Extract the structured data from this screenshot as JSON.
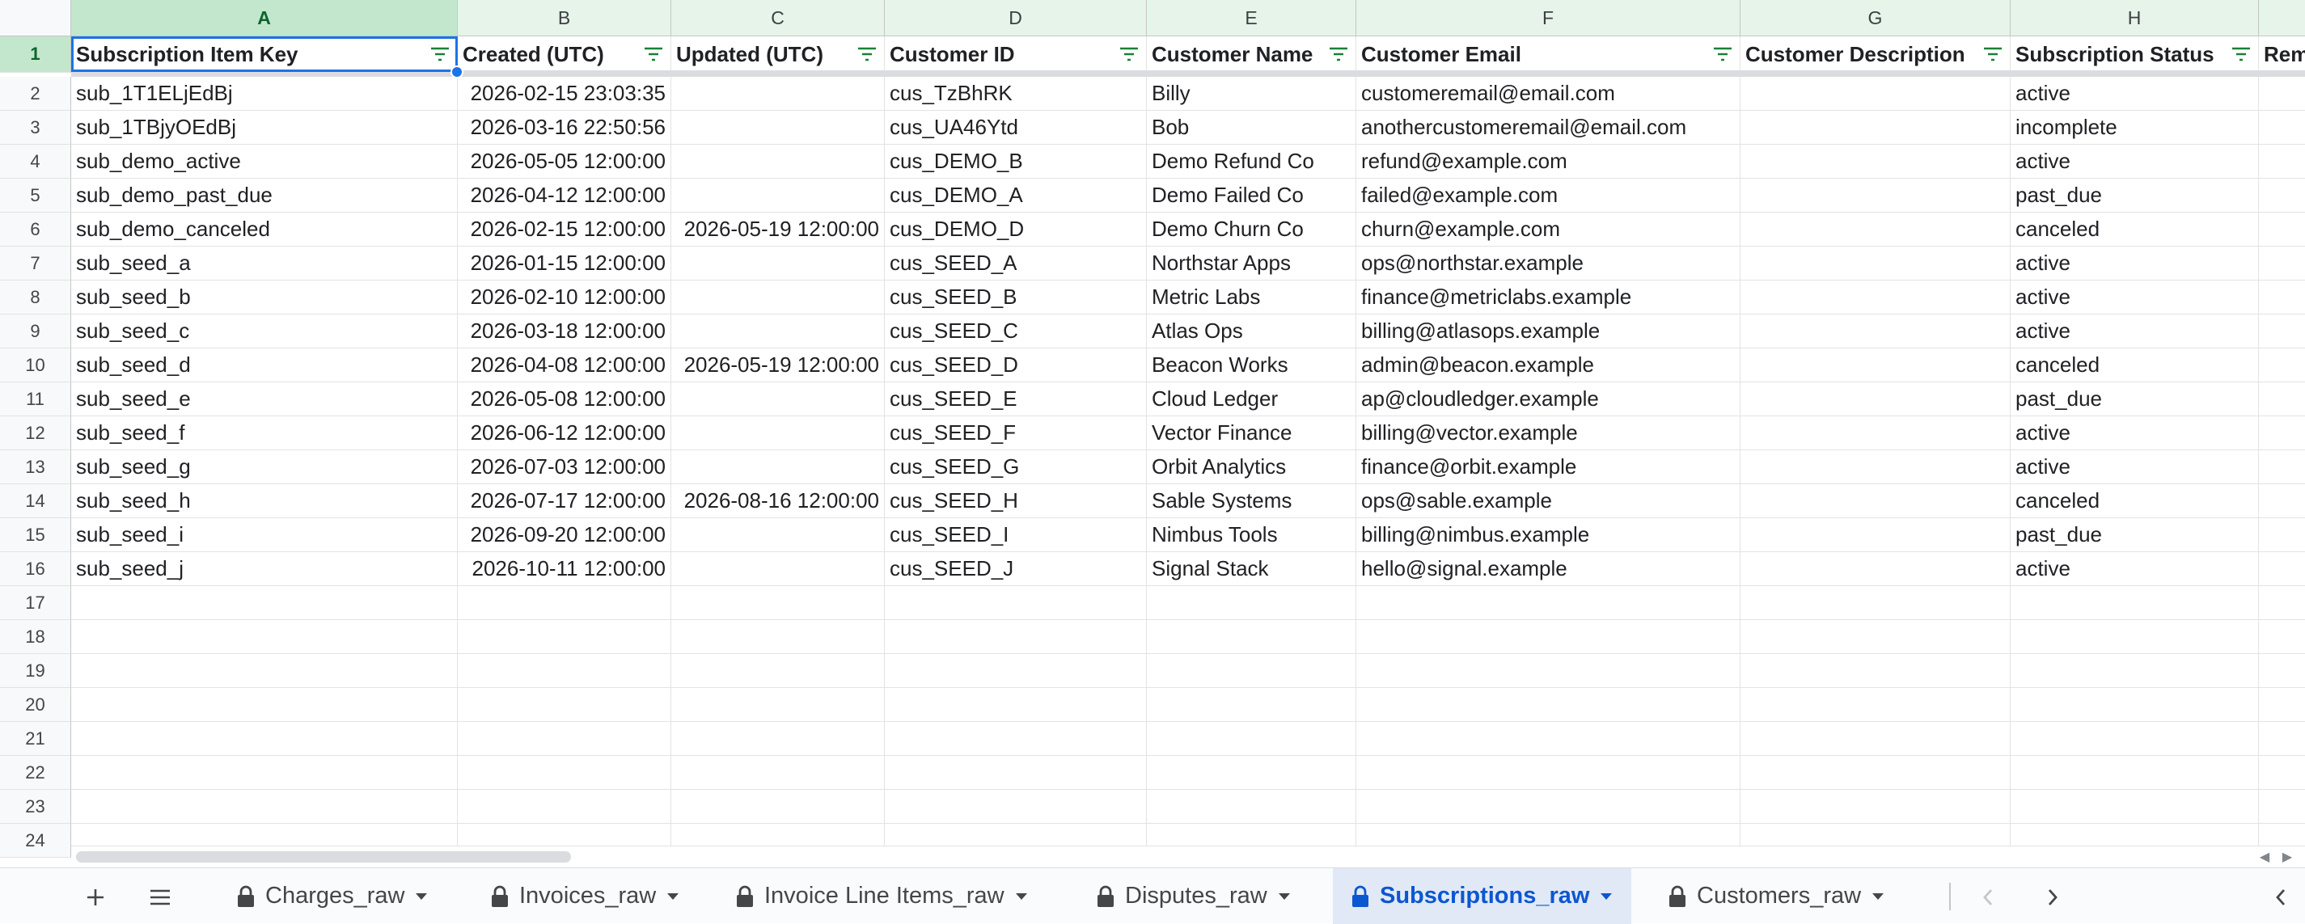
{
  "columns": [
    "A",
    "B",
    "C",
    "D",
    "E",
    "F",
    "G",
    "H",
    ""
  ],
  "headers": [
    "Subscription Item Key",
    "Created (UTC)",
    "Updated (UTC)",
    "Customer ID",
    "Customer Name",
    "Customer Email",
    "Customer Description",
    "Subscription Status",
    "Rem"
  ],
  "rows": [
    [
      "sub_1T1ELjEdBj",
      "2026-02-15 23:03:35",
      "",
      "cus_TzBhRK",
      "Billy",
      "customeremail@email.com",
      "",
      "active"
    ],
    [
      "sub_1TBjyOEdBj",
      "2026-03-16 22:50:56",
      "",
      "cus_UA46Ytd",
      "Bob",
      "anothercustomeremail@email.com",
      "",
      "incomplete"
    ],
    [
      "sub_demo_active",
      "2026-05-05 12:00:00",
      "",
      "cus_DEMO_B",
      "Demo Refund Co",
      "refund@example.com",
      "",
      "active"
    ],
    [
      "sub_demo_past_due",
      "2026-04-12 12:00:00",
      "",
      "cus_DEMO_A",
      "Demo Failed Co",
      "failed@example.com",
      "",
      "past_due"
    ],
    [
      "sub_demo_canceled",
      "2026-02-15 12:00:00",
      "2026-05-19 12:00:00",
      "cus_DEMO_D",
      "Demo Churn Co",
      "churn@example.com",
      "",
      "canceled"
    ],
    [
      "sub_seed_a",
      "2026-01-15 12:00:00",
      "",
      "cus_SEED_A",
      "Northstar Apps",
      "ops@northstar.example",
      "",
      "active"
    ],
    [
      "sub_seed_b",
      "2026-02-10 12:00:00",
      "",
      "cus_SEED_B",
      "Metric Labs",
      "finance@metriclabs.example",
      "",
      "active"
    ],
    [
      "sub_seed_c",
      "2026-03-18 12:00:00",
      "",
      "cus_SEED_C",
      "Atlas Ops",
      "billing@atlasops.example",
      "",
      "active"
    ],
    [
      "sub_seed_d",
      "2026-04-08 12:00:00",
      "2026-05-19 12:00:00",
      "cus_SEED_D",
      "Beacon Works",
      "admin@beacon.example",
      "",
      "canceled"
    ],
    [
      "sub_seed_e",
      "2026-05-08 12:00:00",
      "",
      "cus_SEED_E",
      "Cloud Ledger",
      "ap@cloudledger.example",
      "",
      "past_due"
    ],
    [
      "sub_seed_f",
      "2026-06-12 12:00:00",
      "",
      "cus_SEED_F",
      "Vector Finance",
      "billing@vector.example",
      "",
      "active"
    ],
    [
      "sub_seed_g",
      "2026-07-03 12:00:00",
      "",
      "cus_SEED_G",
      "Orbit Analytics",
      "finance@orbit.example",
      "",
      "active"
    ],
    [
      "sub_seed_h",
      "2026-07-17 12:00:00",
      "2026-08-16 12:00:00",
      "cus_SEED_H",
      "Sable Systems",
      "ops@sable.example",
      "",
      "canceled"
    ],
    [
      "sub_seed_i",
      "2026-09-20 12:00:00",
      "",
      "cus_SEED_I",
      "Nimbus Tools",
      "billing@nimbus.example",
      "",
      "past_due"
    ],
    [
      "sub_seed_j",
      "2026-10-11 12:00:00",
      "",
      "cus_SEED_J",
      "Signal Stack",
      "hello@signal.example",
      "",
      "active"
    ]
  ],
  "row_numbers": [
    "1",
    "2",
    "3",
    "4",
    "5",
    "6",
    "7",
    "8",
    "9",
    "10",
    "11",
    "12",
    "13",
    "14",
    "15",
    "16",
    "17",
    "18",
    "19",
    "20",
    "21",
    "22",
    "23",
    "24"
  ],
  "tabs": [
    {
      "label": "Charges_raw",
      "locked": true,
      "active": false
    },
    {
      "label": "Invoices_raw",
      "locked": true,
      "active": false
    },
    {
      "label": "Invoice Line Items_raw",
      "locked": true,
      "active": false
    },
    {
      "label": "Disputes_raw",
      "locked": true,
      "active": false
    },
    {
      "label": "Subscriptions_raw",
      "locked": true,
      "active": true
    },
    {
      "label": "Customers_raw",
      "locked": true,
      "active": false
    }
  ],
  "icons": {
    "add_sheet": "plus-icon",
    "all_sheets": "menu-icon",
    "filter": "filter-icon",
    "lock": "lock-icon",
    "tab_menu": "caret-down-icon",
    "prev_sheet": "chevron-left-icon",
    "next_sheet": "chevron-right-icon",
    "side_panel": "chevron-left-icon"
  },
  "colors": {
    "accent": "#1a73e8",
    "selected_header": "#c2e7cd",
    "active_tab_bg": "#e1e9f7",
    "active_tab_text": "#0b57d0"
  }
}
